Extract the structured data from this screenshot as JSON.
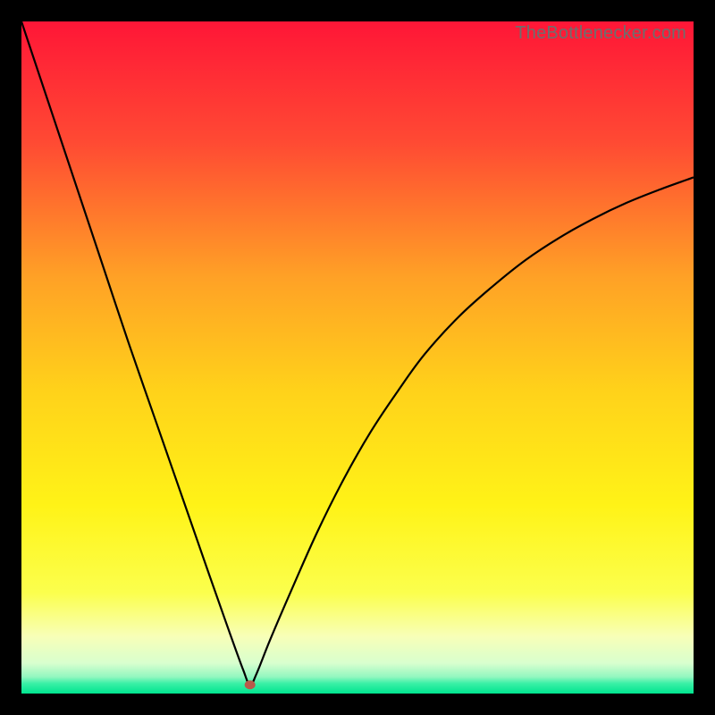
{
  "watermark": "TheBottlenecker.com",
  "colors": {
    "frame": "#000000",
    "curve": "#000000",
    "marker": "#b85a4a",
    "gradient_stops": [
      {
        "offset": 0.0,
        "color": "#ff1637"
      },
      {
        "offset": 0.18,
        "color": "#ff4a33"
      },
      {
        "offset": 0.38,
        "color": "#ffa126"
      },
      {
        "offset": 0.55,
        "color": "#ffd21a"
      },
      {
        "offset": 0.72,
        "color": "#fff317"
      },
      {
        "offset": 0.85,
        "color": "#fbff4d"
      },
      {
        "offset": 0.915,
        "color": "#f8ffb8"
      },
      {
        "offset": 0.955,
        "color": "#d8ffce"
      },
      {
        "offset": 0.975,
        "color": "#93f7c0"
      },
      {
        "offset": 0.985,
        "color": "#3af0a6"
      },
      {
        "offset": 1.0,
        "color": "#00e58f"
      }
    ]
  },
  "chart_data": {
    "type": "line",
    "title": "",
    "xlabel": "",
    "ylabel": "",
    "xlim": [
      0,
      100
    ],
    "ylim": [
      0,
      100
    ],
    "grid": false,
    "legend": false,
    "annotations": [],
    "marker": {
      "x": 34,
      "y": 1.3
    },
    "series": [
      {
        "name": "bottleneck-curve",
        "x": [
          0,
          4,
          8,
          12,
          16,
          20,
          24,
          28,
          31,
          33,
          34,
          35,
          37,
          40,
          44,
          48,
          52,
          56,
          60,
          65,
          70,
          75,
          80,
          85,
          90,
          95,
          100
        ],
        "y": [
          100,
          88,
          76,
          64,
          52,
          40.5,
          29,
          17.5,
          9,
          3.5,
          1.3,
          3,
          8,
          15,
          24,
          32,
          39,
          45,
          50.5,
          56,
          60.5,
          64.5,
          67.8,
          70.6,
          73,
          75,
          76.8
        ]
      }
    ]
  }
}
